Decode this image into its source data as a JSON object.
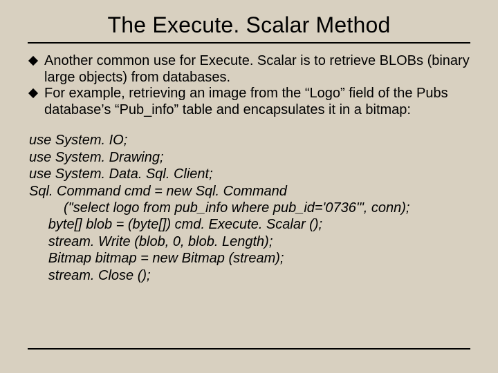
{
  "title": "The Execute. Scalar Method",
  "bullets": [
    "Another common use for Execute. Scalar is to retrieve BLOBs (binary large objects) from databases.",
    "For example, retrieving an image from the “Logo” field of the Pubs database’s “Pub_info” table and encapsulates it in a bitmap:"
  ],
  "code": "use System. IO;\nuse System. Drawing;\nuse System. Data. Sql. Client;\nSql. Command cmd = new Sql. Command\n         (\"select logo from pub_info where pub_id='0736'\", conn);\n     byte[] blob = (byte[]) cmd. Execute. Scalar ();\n     stream. Write (blob, 0, blob. Length);\n     Bitmap bitmap = new Bitmap (stream);\n     stream. Close ();"
}
